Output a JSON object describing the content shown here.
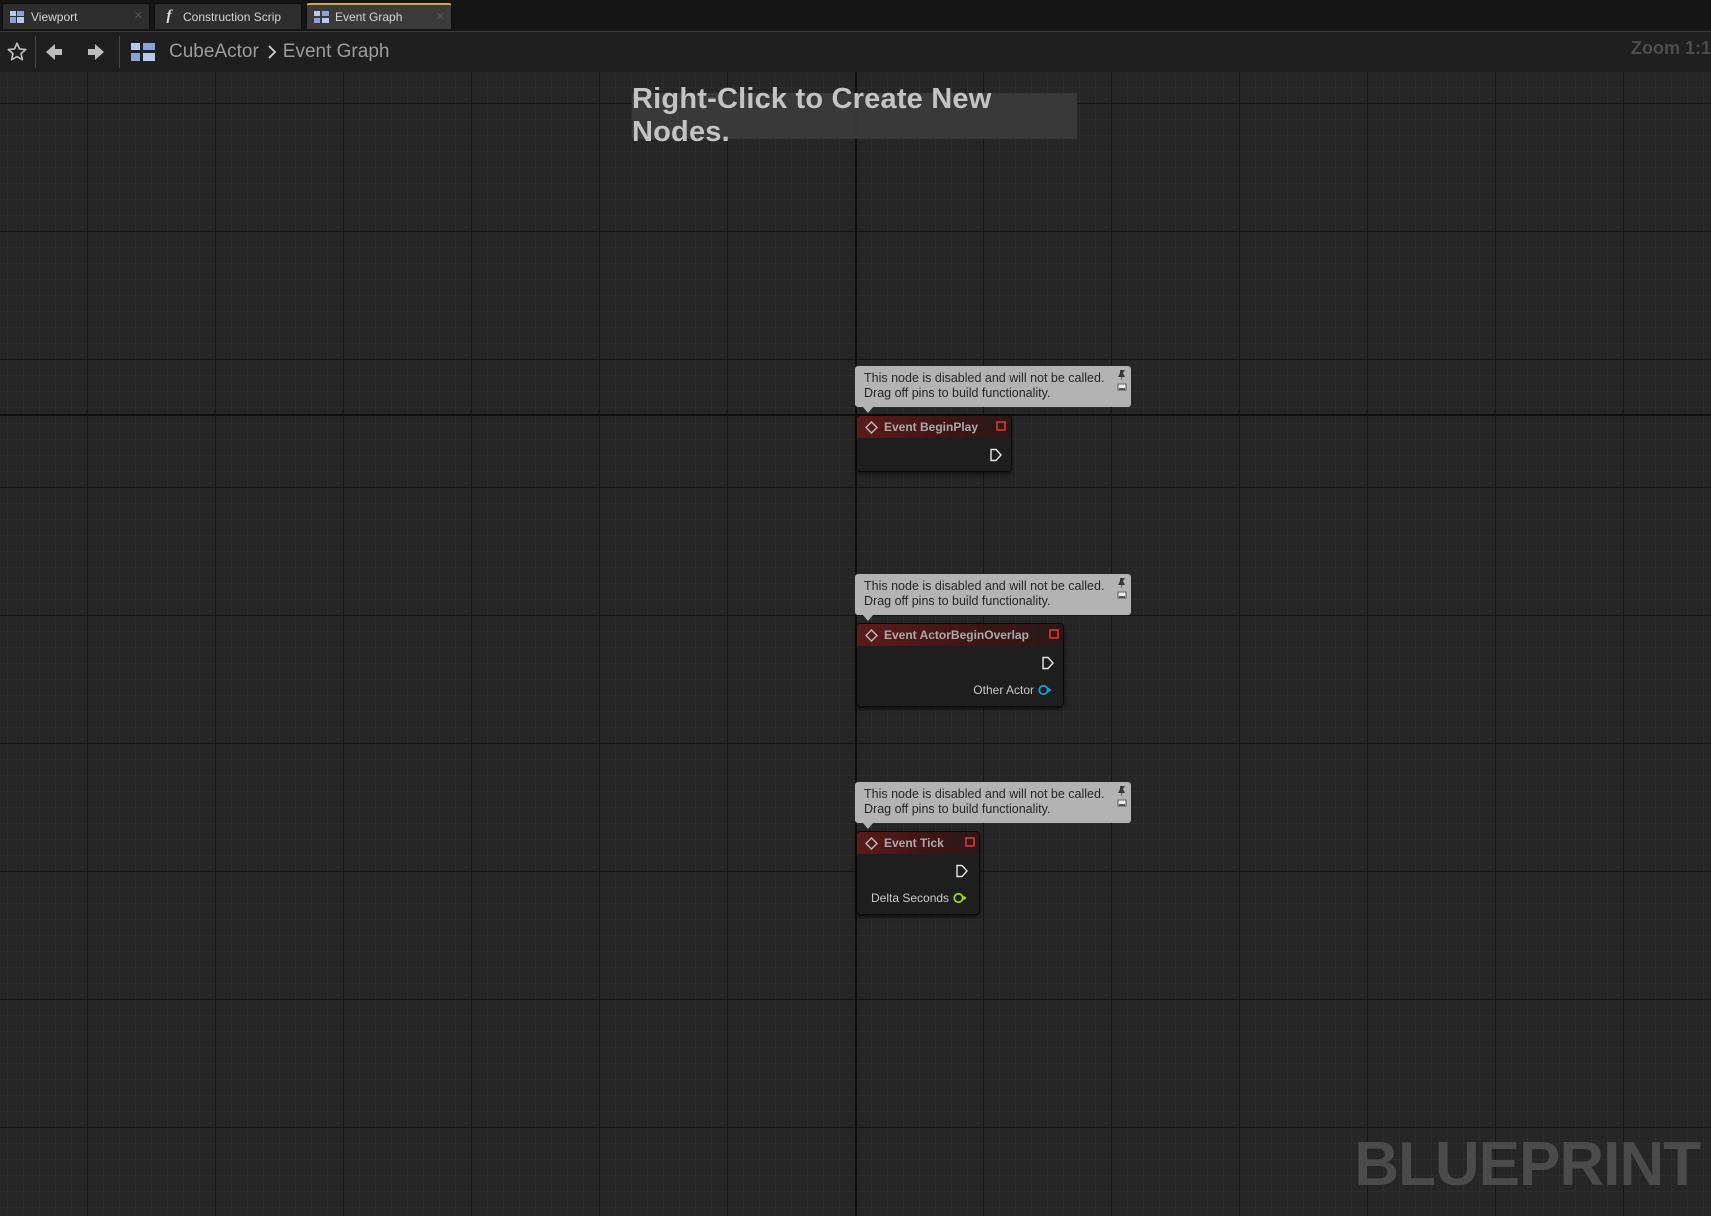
{
  "tabs": [
    {
      "label": "Viewport",
      "icon": "viewport-icon"
    },
    {
      "label": "Construction Scrip",
      "icon": "function-icon"
    },
    {
      "label": "Event Graph",
      "icon": "event-graph-icon",
      "active": true
    }
  ],
  "toolbar": {
    "breadcrumb": [
      "CubeActor",
      "Event Graph"
    ],
    "zoom": "Zoom 1:1"
  },
  "canvas": {
    "hint": "Right-Click to Create New Nodes.",
    "watermark": "BLUEPRINT"
  },
  "nodes": [
    {
      "title": "Event BeginPlay",
      "comment": [
        "This node is disabled and will not be called.",
        "Drag off pins to build functionality."
      ],
      "pins": []
    },
    {
      "title": "Event ActorBeginOverlap",
      "comment": [
        "This node is disabled and will not be called.",
        "Drag off pins to build functionality."
      ],
      "pins": [
        {
          "label": "Other Actor",
          "type": "object"
        }
      ]
    },
    {
      "title": "Event Tick",
      "comment": [
        "This node is disabled and will not be called.",
        "Drag off pins to build functionality."
      ],
      "pins": [
        {
          "label": "Delta Seconds",
          "type": "float"
        }
      ]
    }
  ],
  "colors": {
    "accent_tab": "#d8a72f",
    "event_header": "#5c1a1a",
    "object_pin": "#1d9bd0",
    "float_pin": "#9bd62b",
    "stop_icon": "#e0342e"
  }
}
